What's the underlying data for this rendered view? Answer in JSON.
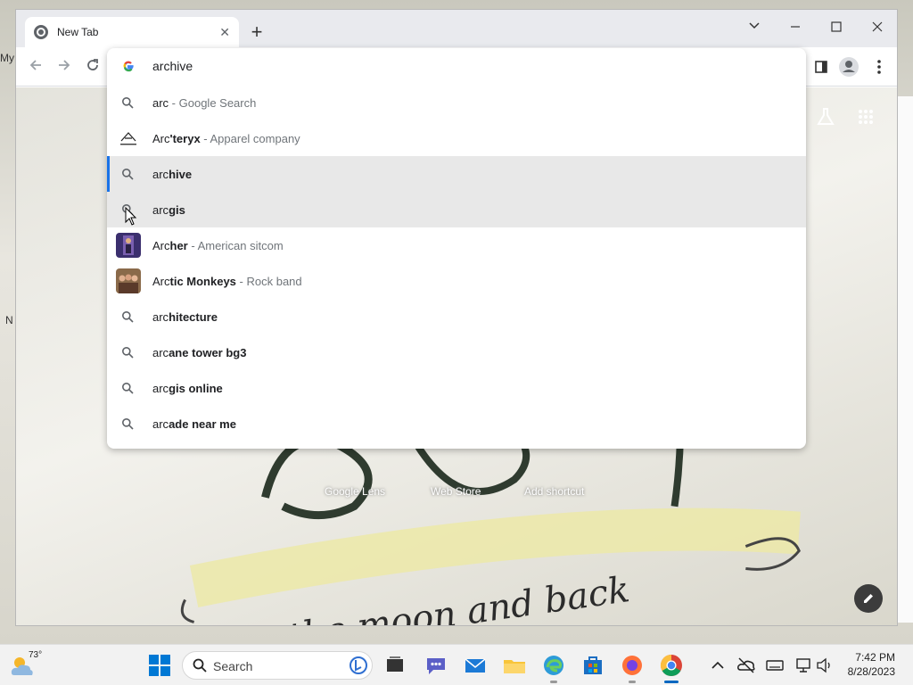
{
  "desktop": {
    "left_labels": [
      "My",
      "N"
    ]
  },
  "browser": {
    "tab_title": "New Tab",
    "window_controls": [
      "tab-search",
      "minimize",
      "maximize",
      "close"
    ]
  },
  "omnibox": {
    "input_value": "archive",
    "suggestions": [
      {
        "prefix": "arc",
        "bold": "",
        "desc": "Google Search",
        "icon": "search-icon"
      },
      {
        "prefix": "Arc",
        "bold": "'teryx",
        "desc": "Apparel company",
        "icon": "arcteryx-logo"
      },
      {
        "prefix": "arc",
        "bold": "hive",
        "desc": "",
        "icon": "search-icon",
        "selected": true
      },
      {
        "prefix": "arc",
        "bold": "gis",
        "desc": "",
        "icon": "search-icon",
        "hovered": true
      },
      {
        "prefix": "Arc",
        "bold": "her",
        "desc": "American sitcom",
        "icon": "archer-thumbnail"
      },
      {
        "prefix": "Arc",
        "bold": "tic Monkeys",
        "desc": "Rock band",
        "icon": "arctic-monkeys-thumbnail"
      },
      {
        "prefix": "arc",
        "bold": "hitecture",
        "desc": "",
        "icon": "search-icon"
      },
      {
        "prefix": "arc",
        "bold": "ane tower bg3",
        "desc": "",
        "icon": "search-icon"
      },
      {
        "prefix": "arc",
        "bold": "gis online",
        "desc": "",
        "icon": "search-icon"
      },
      {
        "prefix": "arc",
        "bold": "ade near me",
        "desc": "",
        "icon": "search-icon"
      }
    ]
  },
  "new_tab_page": {
    "shortcuts": [
      "Google Lens",
      "Web Store",
      "Add shortcut"
    ],
    "artwork_text": "To the moon and back"
  },
  "taskbar": {
    "weather_temp": "73°",
    "search_label": "Search",
    "time": "7:42 PM",
    "date": "8/28/2023"
  },
  "colors": {
    "accent": "#1a73e8",
    "highlight": "#e8e8e8",
    "desc_text": "#70757a"
  }
}
